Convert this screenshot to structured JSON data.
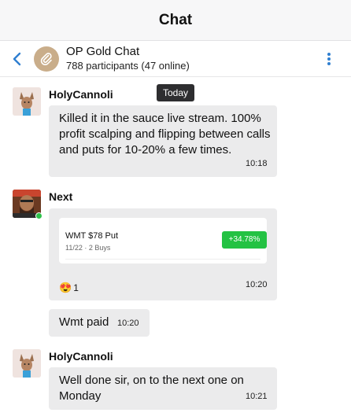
{
  "topbar": {
    "title": "Chat"
  },
  "chat": {
    "name": "OP Gold Chat",
    "participants": "788 participants (47 online)"
  },
  "date_divider": "Today",
  "messages": [
    {
      "sender": "HolyCannoli",
      "text": "Killed it in the sauce live stream. 100% profit scalping and flipping between calls and puts for 10-20% a few times.",
      "time": "10:18"
    },
    {
      "sender": "Next",
      "card": {
        "title": "WMT $78 Put",
        "meta": "11/22 · 2 Buys",
        "change": "+34.78%"
      },
      "reaction": {
        "emoji": "😍",
        "count": "1"
      },
      "time": "10:20"
    },
    {
      "text": "Wmt paid",
      "time": "10:20"
    },
    {
      "sender": "HolyCannoli",
      "text": "Well done sir, on to the next one on Monday",
      "time": "10:21"
    }
  ],
  "colors": {
    "accent": "#2f7fd0",
    "bubble": "#ebebec",
    "gain": "#23c243",
    "online": "#2ec24a"
  }
}
